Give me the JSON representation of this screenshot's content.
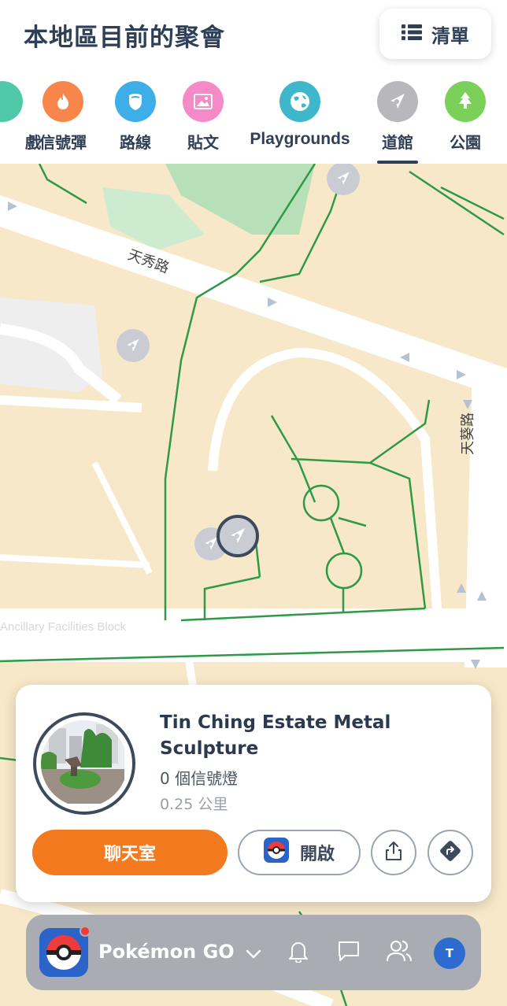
{
  "header": {
    "title": "本地區目前的聚會",
    "list_button_label": "清單"
  },
  "categories": [
    {
      "label": "戲",
      "icon": "gaming-icon",
      "color": "#4fc9a8"
    },
    {
      "label": "信號彈",
      "icon": "flare-icon",
      "color": "#f8864a"
    },
    {
      "label": "路線",
      "icon": "route-icon",
      "color": "#3daee8"
    },
    {
      "label": "貼文",
      "icon": "post-icon",
      "color": "#f48ac7"
    },
    {
      "label": "Playgrounds",
      "icon": "globe-icon",
      "color": "#3db7c9"
    },
    {
      "label": "道館",
      "icon": "gym-icon",
      "color": "#b8b8bc",
      "selected": true
    },
    {
      "label": "公園",
      "icon": "tree-icon",
      "color": "#7bd05a"
    }
  ],
  "map": {
    "street_labels": [
      "天秀路",
      "天葵路",
      "Ancillary Facilities Block"
    ]
  },
  "card": {
    "title": "Tin Ching Estate Metal Sculpture",
    "beacons": "0 個信號燈",
    "distance": "0.25 公里",
    "chat_button_label": "聊天室",
    "open_button_label": "開啟"
  },
  "bottom_bar": {
    "app_name": "Pokémon GO",
    "avatar_initial": "T"
  },
  "colors": {
    "accent_orange": "#f47a20",
    "map_background": "#f7e8c9",
    "road_green": "#2e9a48",
    "text_dark": "#2f3f55"
  }
}
